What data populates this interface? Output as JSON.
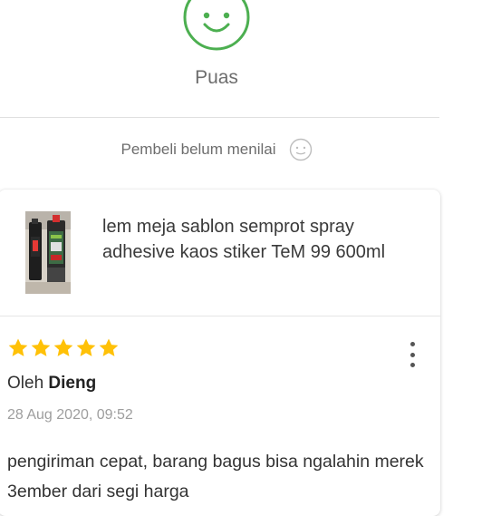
{
  "rating": {
    "label": "Puas",
    "icon": "smile-face-icon",
    "color": "#4caf50"
  },
  "seller_status": {
    "text": "Pembeli belum menilai",
    "icon": "neutral-face-icon"
  },
  "product": {
    "name": "lem meja sablon semprot spray adhesive kaos stiker TeM 99 600ml",
    "thumbnail": "spray-can-product-image"
  },
  "review": {
    "stars": 5,
    "star_color": "#ffc107",
    "author_prefix": "Oleh",
    "author_name": "Dieng",
    "date": "28 Aug 2020, 09:52",
    "text": "pengiriman cepat, barang bagus bisa ngalahin merek 3ember  dari segi harga",
    "menu_icon": "more-vertical-icon"
  }
}
